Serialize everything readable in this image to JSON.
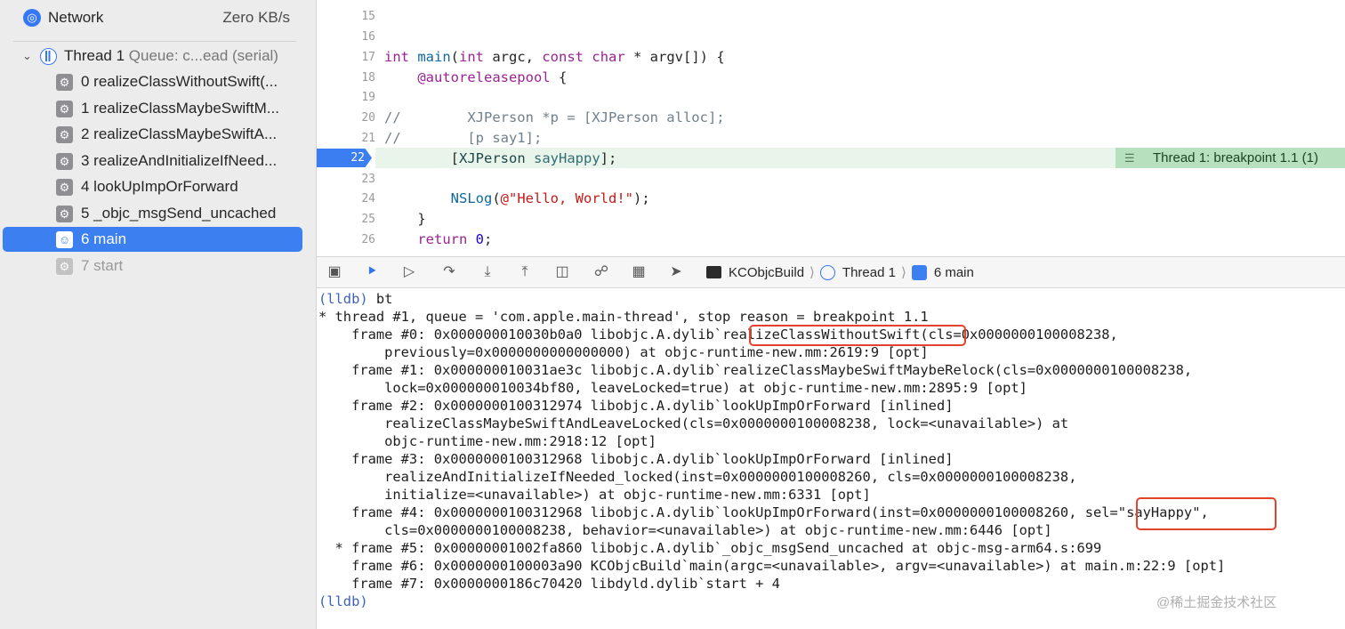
{
  "navigator": {
    "network": {
      "label": "Network",
      "rate": "Zero KB/s",
      "icon": "globe-icon"
    },
    "thread": {
      "label": "Thread 1",
      "queue": "Queue: c...ead (serial)"
    },
    "frames": [
      {
        "label": "0 realizeClassWithoutSwift(...",
        "state": "normal"
      },
      {
        "label": "1 realizeClassMaybeSwiftM...",
        "state": "normal"
      },
      {
        "label": "2 realizeClassMaybeSwiftA...",
        "state": "normal"
      },
      {
        "label": "3 realizeAndInitializeIfNeed...",
        "state": "normal"
      },
      {
        "label": "4 lookUpImpOrForward",
        "state": "normal"
      },
      {
        "label": "5 _objc_msgSend_uncached",
        "state": "normal"
      },
      {
        "label": "6 main",
        "state": "selected"
      },
      {
        "label": "7 start",
        "state": "dimmed"
      }
    ]
  },
  "editor": {
    "line_numbers": [
      "15",
      "16",
      "17",
      "18",
      "19",
      "20",
      "21",
      "22",
      "23",
      "24",
      "25",
      "26"
    ],
    "current_line": "22",
    "breakpoint_label": "Thread 1: breakpoint 1.1 (1)"
  },
  "debug_bar": {
    "crumbs": [
      "KCObjcBuild",
      "Thread 1",
      "6 main"
    ]
  },
  "console": {
    "prompt": "(lldb)",
    "command": "bt",
    "highlights": [
      "realizeClassWithoutSwift",
      "sel=\"sayHappy\","
    ],
    "lines": [
      "* thread #1, queue = 'com.apple.main-thread', stop reason = breakpoint 1.1",
      "    frame #0: 0x000000010030b0a0 libobjc.A.dylib`realizeClassWithoutSwift(cls=0x0000000100008238,",
      "        previously=0x0000000000000000) at objc-runtime-new.mm:2619:9 [opt]",
      "    frame #1: 0x000000010031ae3c libobjc.A.dylib`realizeClassMaybeSwiftMaybeRelock(cls=0x0000000100008238,",
      "        lock=0x000000010034bf80, leaveLocked=true) at objc-runtime-new.mm:2895:9 [opt]",
      "    frame #2: 0x0000000100312974 libobjc.A.dylib`lookUpImpOrForward [inlined]",
      "        realizeClassMaybeSwiftAndLeaveLocked(cls=0x0000000100008238, lock=<unavailable>) at",
      "        objc-runtime-new.mm:2918:12 [opt]",
      "    frame #3: 0x0000000100312968 libobjc.A.dylib`lookUpImpOrForward [inlined]",
      "        realizeAndInitializeIfNeeded_locked(inst=0x0000000100008260, cls=0x0000000100008238,",
      "        initialize=<unavailable>) at objc-runtime-new.mm:6331 [opt]",
      "    frame #4: 0x0000000100312968 libobjc.A.dylib`lookUpImpOrForward(inst=0x0000000100008260, sel=\"sayHappy\",",
      "        cls=0x0000000100008238, behavior=<unavailable>) at objc-runtime-new.mm:6446 [opt]",
      "  * frame #5: 0x00000001002fa860 libobjc.A.dylib`_objc_msgSend_uncached at objc-msg-arm64.s:699",
      "    frame #6: 0x0000000100003a90 KCObjcBuild`main(argc=<unavailable>, argv=<unavailable>) at main.m:22:9 [opt]",
      "    frame #7: 0x0000000186c70420 libdyld.dylib`start + 4"
    ],
    "end_prompt": "(lldb)"
  },
  "watermark": "@稀土掘金技术社区"
}
